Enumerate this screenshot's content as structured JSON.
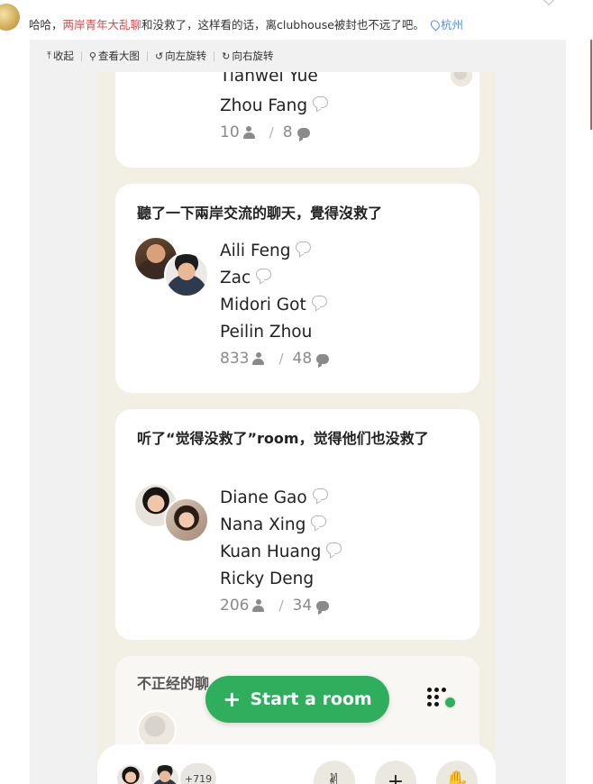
{
  "post": {
    "text_before": "哈哈，",
    "highlight": "两岸青年大乱聊",
    "text_after": "和没救了，这样看的话，离clubhouse被封也不远了吧。",
    "location": "杭州"
  },
  "toolbar": {
    "collapse": "收起",
    "view_large": "查看大图",
    "rotate_left": "向左旋转",
    "rotate_right": "向右旋转"
  },
  "rooms": [
    {
      "partial_top_name": "Tianwei Yue",
      "speakers": [
        "Zhou Fang"
      ],
      "listeners": "10",
      "speaking": "8"
    },
    {
      "title": "聽了一下兩岸交流的聊天，覺得沒救了",
      "speakers": [
        "Aili Feng",
        "Zac",
        "Midori Got",
        "Peilin Zhou"
      ],
      "listeners": "833",
      "speaking": "48"
    },
    {
      "title": "听了“觉得没救了”room，觉得他们也没救了",
      "speakers": [
        "Diane Gao",
        "Nana Xing",
        "Kuan Huang",
        "Ricky Deng"
      ],
      "listeners": "206",
      "speaking": "34"
    },
    {
      "title": "不正经的聊"
    }
  ],
  "actions": {
    "start_room": "Start a room"
  },
  "bottom": {
    "online_count": "+719"
  },
  "colors": {
    "accent_green": "#2fae5d",
    "highlight_red": "#e3474a",
    "link_blue": "#5a8fd8",
    "phone_bg": "#f2efe5"
  }
}
